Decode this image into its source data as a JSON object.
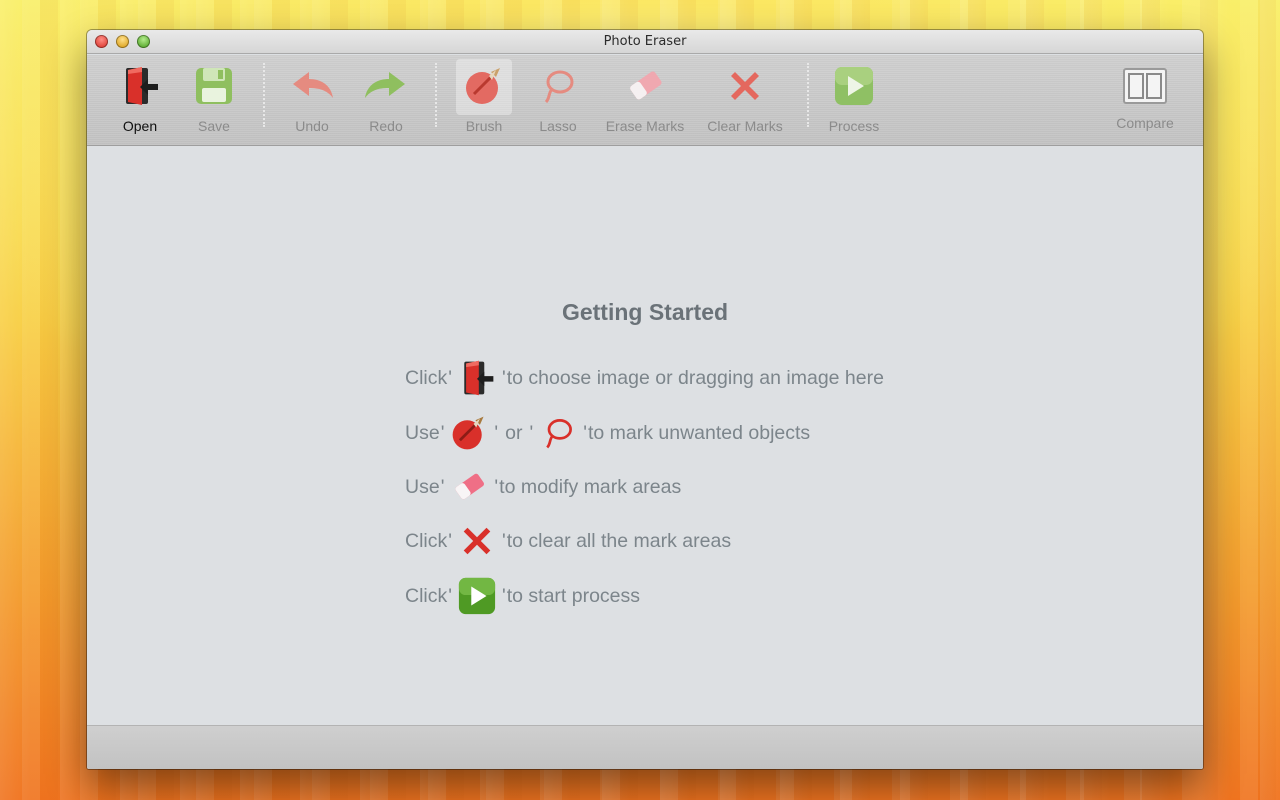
{
  "window": {
    "title": "Photo Eraser"
  },
  "toolbar": {
    "open": "Open",
    "save": "Save",
    "undo": "Undo",
    "redo": "Redo",
    "brush": "Brush",
    "lasso": "Lasso",
    "erase_marks": "Erase Marks",
    "clear_marks": "Clear Marks",
    "process": "Process",
    "compare": "Compare"
  },
  "guide": {
    "title": "Getting Started",
    "lines": [
      {
        "prefix": "Click",
        "suffix": "to choose image or dragging an image here"
      },
      {
        "prefix": "Use",
        "middle": "or",
        "suffix": "to mark unwanted objects"
      },
      {
        "prefix": "Use",
        "suffix": "to modify mark areas"
      },
      {
        "prefix": "Click",
        "suffix": "to clear all the mark areas"
      },
      {
        "prefix": "Click",
        "suffix": "to start process"
      }
    ],
    "quote": "'"
  },
  "icons": {
    "open": "open-door-icon",
    "save": "floppy-disk-icon",
    "undo": "undo-arrow-icon",
    "redo": "redo-arrow-icon",
    "brush": "brush-icon",
    "lasso": "lasso-icon",
    "erase": "eraser-icon",
    "clear": "red-x-icon",
    "process": "play-icon",
    "compare": "split-view-icon"
  },
  "colors": {
    "accent_red": "#d9302a",
    "process_green": "#4f9a24",
    "canvas_bg": "#dde0e3",
    "toolbar_bg": "#c8c8c8"
  }
}
